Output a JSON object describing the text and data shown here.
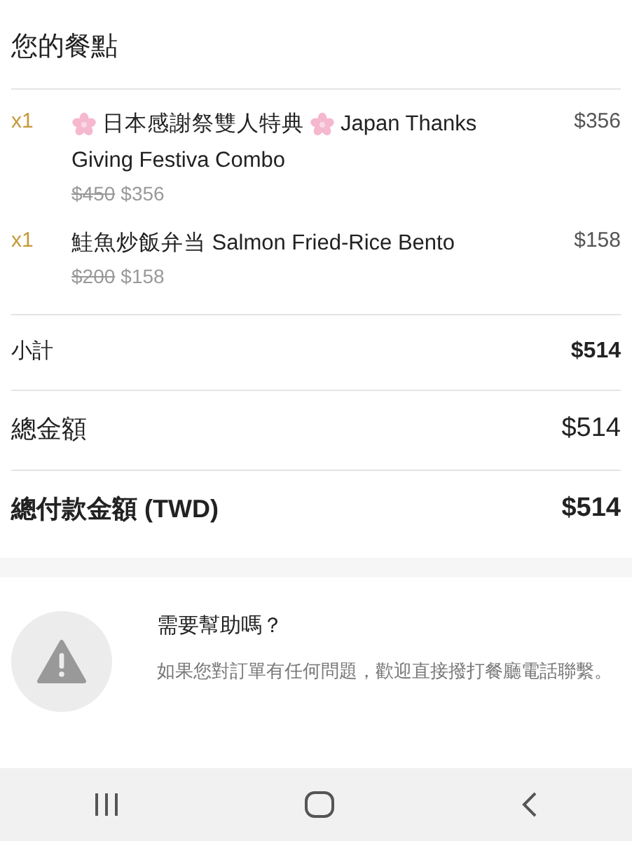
{
  "title": "您的餐點",
  "items": [
    {
      "quantity": "x1",
      "name_lines": [
        [
          {
            "kind": "flower"
          },
          {
            "kind": "text",
            "text": "日本感謝祭雙人特典"
          },
          {
            "kind": "flower"
          },
          {
            "kind": "text",
            "text": "Japan Thanks"
          }
        ],
        [
          {
            "kind": "text",
            "text": "Giving Festiva Combo"
          }
        ]
      ],
      "price": "$356",
      "original_price": "$450",
      "sale_price": "$356"
    },
    {
      "quantity": "x1",
      "name_lines": [
        [
          {
            "kind": "text",
            "text": "鮭魚炒飯弁当 Salmon Fried-Rice Bento"
          }
        ]
      ],
      "price": "$158",
      "original_price": "$200",
      "sale_price": "$158"
    }
  ],
  "totals": [
    {
      "kind": "small",
      "label": "小計",
      "value": "$514"
    },
    {
      "kind": "medium",
      "label": "總金額",
      "value": "$514"
    },
    {
      "kind": "bold",
      "label": "總付款金額 (TWD)",
      "value": "$514"
    }
  ],
  "help": {
    "title": "需要幫助嗎？",
    "text": "如果您對訂單有任何問題，歡迎直接撥打餐廳電話聯繫。"
  },
  "nav_bar": [
    {
      "kind": "recent-apps"
    },
    {
      "kind": "home"
    },
    {
      "kind": "back"
    }
  ]
}
